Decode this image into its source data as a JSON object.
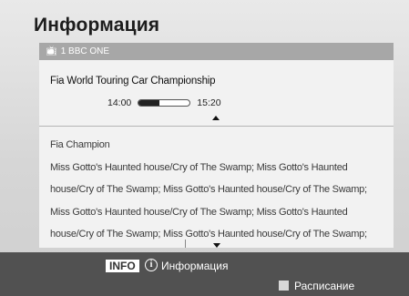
{
  "header": {
    "title": "Информация"
  },
  "channel": {
    "icon": "tv-icon",
    "name": "1 BBC ONE"
  },
  "program": {
    "title": "Fia World Touring Car Championship",
    "start_time": "14:00",
    "end_time": "15:20",
    "progress_fraction": 0.4
  },
  "description": {
    "heading": "Fia Champion",
    "body": "Miss Gotto's Haunted house/Cry of The Swamp; Miss Gotto's Haunted house/Cry of The Swamp; Miss Gotto's Haunted house/Cry of The Swamp; Miss Gotto's Haunted house/Cry of The Swamp; Miss Gotto's Haunted house/Cry of The Swamp; Miss Gotto's Haunted house/Cry of The Swamp; Miss Gotto's Haunted"
  },
  "footer": {
    "info_key": "INFO",
    "info_icon": "info-icon",
    "info_label": "Информация",
    "schedule_label": "Расписание",
    "schedule_color": "#d8d8d8"
  }
}
